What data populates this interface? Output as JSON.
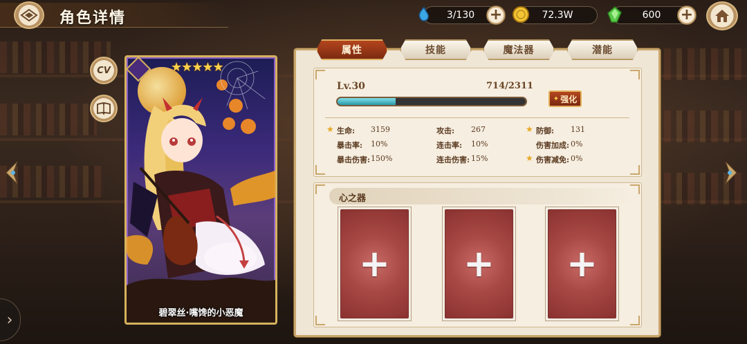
{
  "header": {
    "title": "角色详情",
    "resources": {
      "stamina": "3/130",
      "gold": "72.3W",
      "gems": "600"
    }
  },
  "side": {
    "cv_label": "CV"
  },
  "character": {
    "name": "碧翠丝·嘴馋的小恶魔",
    "star_count": "★★★★★"
  },
  "tabs": [
    {
      "label": "属性",
      "active": true
    },
    {
      "label": "技能",
      "active": false
    },
    {
      "label": "魔法器",
      "active": false
    },
    {
      "label": "潜能",
      "active": false
    }
  ],
  "level": {
    "label": "Lv.30",
    "exp_text": "714/2311",
    "exp_fraction": 0.309,
    "enhance_label": "强化"
  },
  "stats": {
    "hp_label": "生命:",
    "hp_value": "3159",
    "atk_label": "攻击:",
    "atk_value": "267",
    "def_label": "防御:",
    "def_value": "131",
    "crit_label": "暴击率:",
    "crit_value": "10%",
    "combo_label": "连击率:",
    "combo_value": "10%",
    "dmg_bonus_label": "伤害加成:",
    "dmg_bonus_value": "0%",
    "crit_dmg_label": "暴击伤害:",
    "crit_dmg_value": "150%",
    "combo_dmg_label": "连击伤害:",
    "combo_dmg_value": "15%",
    "dmg_reduce_label": "伤害减免:",
    "dmg_reduce_value": "0%"
  },
  "heart": {
    "title": "心之器",
    "slot_plus": "+"
  },
  "colors": {
    "accent_red": "#9a3418",
    "gold_border": "#c9a66b",
    "exp_bar": "#2a98a8"
  }
}
